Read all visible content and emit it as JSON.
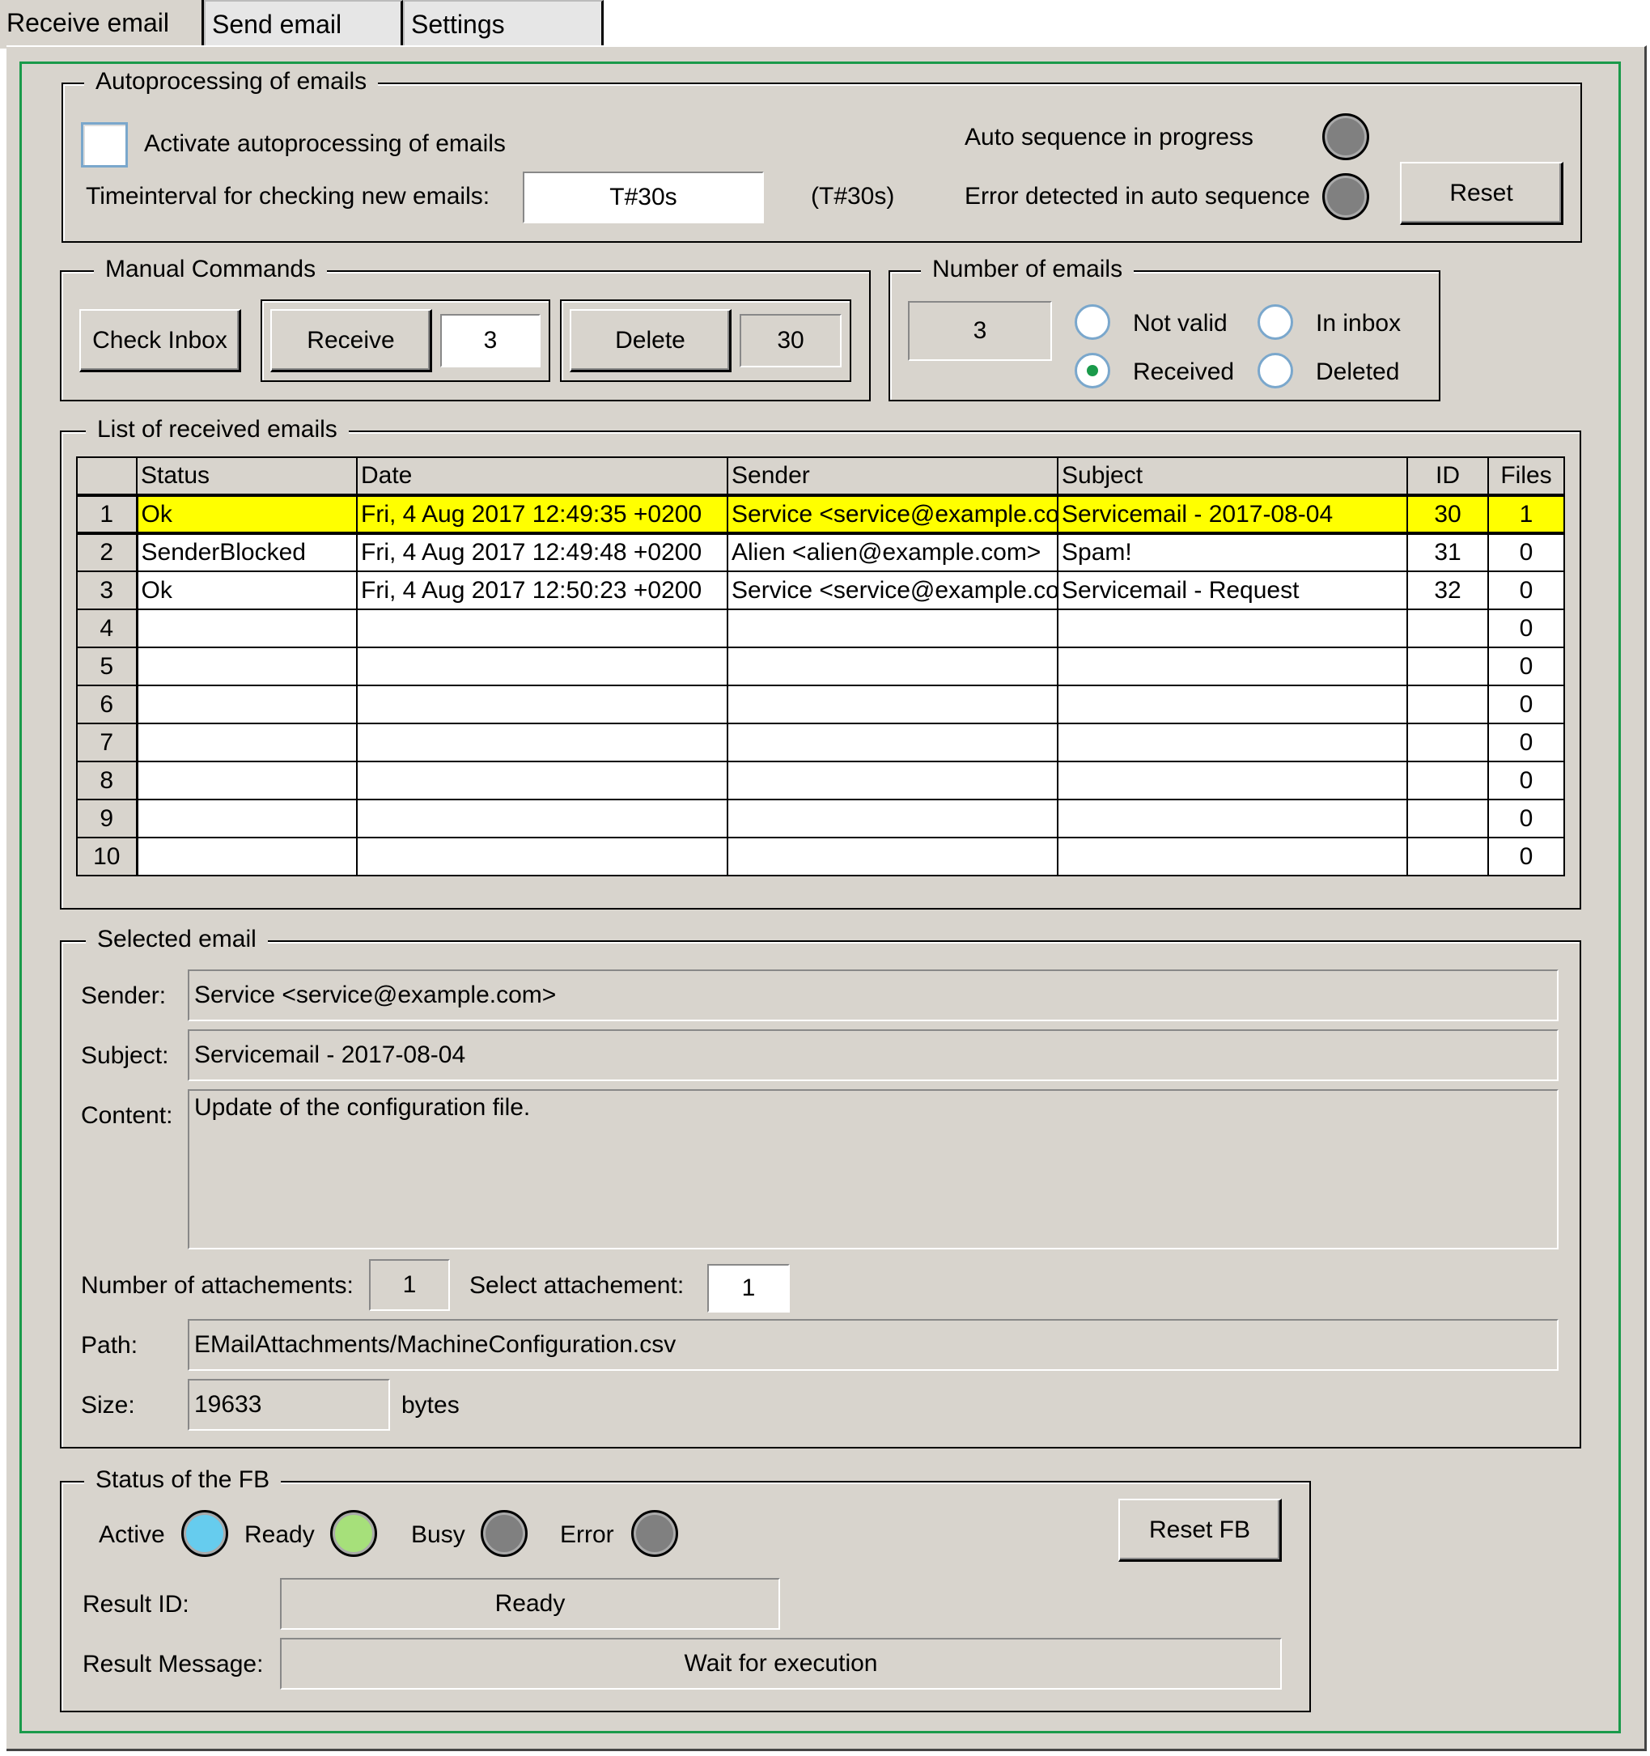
{
  "tabs": [
    {
      "label": "Receive email"
    },
    {
      "label": "Send email"
    },
    {
      "label": "Settings"
    }
  ],
  "autoprocessing": {
    "legend": "Autoprocessing of emails",
    "activate_label": "Activate autoprocessing of emails",
    "activate_checked": false,
    "interval_label": "Timeinterval for checking new emails:",
    "interval_value": "T#30s",
    "interval_hint": "(T#30s)",
    "in_progress_label": "Auto sequence in progress",
    "error_label": "Error detected in auto sequence",
    "reset_label": "Reset"
  },
  "manual": {
    "legend": "Manual Commands",
    "check_inbox_label": "Check Inbox",
    "receive_label": "Receive",
    "receive_value": "3",
    "delete_label": "Delete",
    "delete_value": "30"
  },
  "count": {
    "legend": "Number of emails",
    "value": "3",
    "options": [
      {
        "label": "Not valid",
        "selected": false
      },
      {
        "label": "In inbox",
        "selected": false
      },
      {
        "label": "Received",
        "selected": true
      },
      {
        "label": "Deleted",
        "selected": false
      }
    ]
  },
  "list": {
    "legend": "List of received emails",
    "columns": [
      "Status",
      "Date",
      "Sender",
      "Subject",
      "ID",
      "Files"
    ],
    "rows": [
      {
        "n": "1",
        "status": "Ok",
        "date": "Fri, 4 Aug 2017 12:49:35 +0200",
        "sender": "Service <service@example.com>",
        "subject": "Servicemail - 2017-08-04",
        "id": "30",
        "files": "1"
      },
      {
        "n": "2",
        "status": "SenderBlocked",
        "date": "Fri, 4 Aug 2017 12:49:48 +0200",
        "sender": "Alien <alien@example.com>",
        "subject": "Spam!",
        "id": "31",
        "files": "0"
      },
      {
        "n": "3",
        "status": "Ok",
        "date": "Fri, 4 Aug 2017 12:50:23 +0200",
        "sender": "Service <service@example.com>",
        "subject": "Servicemail - Request",
        "id": "32",
        "files": "0"
      },
      {
        "n": "4",
        "status": "",
        "date": "",
        "sender": "",
        "subject": "",
        "id": "",
        "files": "0"
      },
      {
        "n": "5",
        "status": "",
        "date": "",
        "sender": "",
        "subject": "",
        "id": "",
        "files": "0"
      },
      {
        "n": "6",
        "status": "",
        "date": "",
        "sender": "",
        "subject": "",
        "id": "",
        "files": "0"
      },
      {
        "n": "7",
        "status": "",
        "date": "",
        "sender": "",
        "subject": "",
        "id": "",
        "files": "0"
      },
      {
        "n": "8",
        "status": "",
        "date": "",
        "sender": "",
        "subject": "",
        "id": "",
        "files": "0"
      },
      {
        "n": "9",
        "status": "",
        "date": "",
        "sender": "",
        "subject": "",
        "id": "",
        "files": "0"
      },
      {
        "n": "10",
        "status": "",
        "date": "",
        "sender": "",
        "subject": "",
        "id": "",
        "files": "0"
      }
    ]
  },
  "selected": {
    "legend": "Selected email",
    "sender_label": "Sender:",
    "sender_value": "Service <service@example.com>",
    "subject_label": "Subject:",
    "subject_value": "Servicemail - 2017-08-04",
    "content_label": "Content:",
    "content_value": "Update of the configuration file.",
    "num_attach_label": "Number of attachements:",
    "num_attach_value": "1",
    "select_attach_label": "Select attachement:",
    "select_attach_value": "1",
    "path_label": "Path:",
    "path_value": "EMailAttachments/MachineConfiguration.csv",
    "size_label": "Size:",
    "size_value": "19633",
    "size_unit": "bytes"
  },
  "fb": {
    "legend": "Status of the FB",
    "active_label": "Active",
    "ready_label": "Ready",
    "busy_label": "Busy",
    "error_label": "Error",
    "reset_label": "Reset FB",
    "result_id_label": "Result ID:",
    "result_id_value": "Ready",
    "result_msg_label": "Result Message:",
    "result_msg_value": "Wait for execution"
  },
  "colors": {
    "panel": "#d8d4cd",
    "frame": "#1a9a4a",
    "selected_row": "#ffff00",
    "led_off": "#808080",
    "led_active": "#66ccee",
    "led_ready": "#a6e07a"
  }
}
